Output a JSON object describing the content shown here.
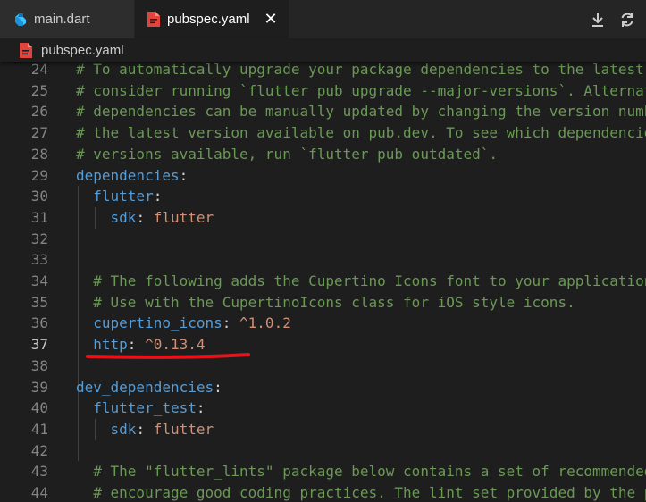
{
  "tabs": [
    {
      "label": "main.dart",
      "icon": "dart-icon",
      "active": false
    },
    {
      "label": "pubspec.yaml",
      "icon": "yaml-icon",
      "active": true,
      "close": "✕"
    }
  ],
  "toolbar": {
    "icons": [
      "download-icon",
      "refresh-icon"
    ]
  },
  "breadcrumb": {
    "label": "pubspec.yaml"
  },
  "colors": {
    "comment": "#6a9955",
    "key": "#569cd6",
    "value": "#ce9178",
    "annotation": "#e0161c"
  },
  "lines": [
    {
      "num": "24",
      "parts": [
        {
          "t": "# To automatically upgrade your package dependencies to the latest",
          "c": "comment"
        }
      ]
    },
    {
      "num": "25",
      "parts": [
        {
          "t": "# consider running `flutter pub upgrade --major-versions`. Alternat",
          "c": "comment"
        }
      ]
    },
    {
      "num": "26",
      "parts": [
        {
          "t": "# dependencies can be manually updated by changing the version numb",
          "c": "comment"
        }
      ]
    },
    {
      "num": "27",
      "parts": [
        {
          "t": "# the latest version available on pub.dev. To see which dependencie",
          "c": "comment"
        }
      ]
    },
    {
      "num": "28",
      "parts": [
        {
          "t": "# versions available, run `flutter pub outdated`.",
          "c": "comment"
        }
      ]
    },
    {
      "num": "29",
      "parts": [
        {
          "t": "dependencies",
          "c": "key"
        },
        {
          "t": ":",
          "c": "punct"
        }
      ]
    },
    {
      "num": "30",
      "parts": [
        {
          "t": "  ",
          "c": "punct"
        },
        {
          "t": "flutter",
          "c": "key"
        },
        {
          "t": ":",
          "c": "punct"
        }
      ]
    },
    {
      "num": "31",
      "parts": [
        {
          "t": "    ",
          "c": "punct"
        },
        {
          "t": "sdk",
          "c": "key"
        },
        {
          "t": ": ",
          "c": "punct"
        },
        {
          "t": "flutter",
          "c": "val"
        }
      ]
    },
    {
      "num": "32",
      "parts": []
    },
    {
      "num": "33",
      "parts": []
    },
    {
      "num": "34",
      "parts": [
        {
          "t": "  # The following adds the Cupertino Icons font to your application",
          "c": "comment"
        }
      ]
    },
    {
      "num": "35",
      "parts": [
        {
          "t": "  # Use with the CupertinoIcons class for iOS style icons.",
          "c": "comment"
        }
      ]
    },
    {
      "num": "36",
      "parts": [
        {
          "t": "  ",
          "c": "punct"
        },
        {
          "t": "cupertino_icons",
          "c": "key"
        },
        {
          "t": ": ",
          "c": "punct"
        },
        {
          "t": "^1.0.2",
          "c": "val"
        }
      ]
    },
    {
      "num": "37",
      "current": true,
      "parts": [
        {
          "t": "  ",
          "c": "punct"
        },
        {
          "t": "http",
          "c": "key"
        },
        {
          "t": ": ",
          "c": "punct"
        },
        {
          "t": "^0.13.4",
          "c": "val"
        }
      ]
    },
    {
      "num": "38",
      "parts": []
    },
    {
      "num": "39",
      "parts": [
        {
          "t": "dev_dependencies",
          "c": "key"
        },
        {
          "t": ":",
          "c": "punct"
        }
      ]
    },
    {
      "num": "40",
      "parts": [
        {
          "t": "  ",
          "c": "punct"
        },
        {
          "t": "flutter_test",
          "c": "key"
        },
        {
          "t": ":",
          "c": "punct"
        }
      ]
    },
    {
      "num": "41",
      "parts": [
        {
          "t": "    ",
          "c": "punct"
        },
        {
          "t": "sdk",
          "c": "key"
        },
        {
          "t": ": ",
          "c": "punct"
        },
        {
          "t": "flutter",
          "c": "val"
        }
      ]
    },
    {
      "num": "42",
      "parts": []
    },
    {
      "num": "43",
      "parts": [
        {
          "t": "  # The \"flutter_lints\" package below contains a set of recommended",
          "c": "comment"
        }
      ]
    },
    {
      "num": "44",
      "parts": [
        {
          "t": "  # encourage good coding practices. The lint set provided by the p",
          "c": "comment"
        }
      ]
    }
  ]
}
